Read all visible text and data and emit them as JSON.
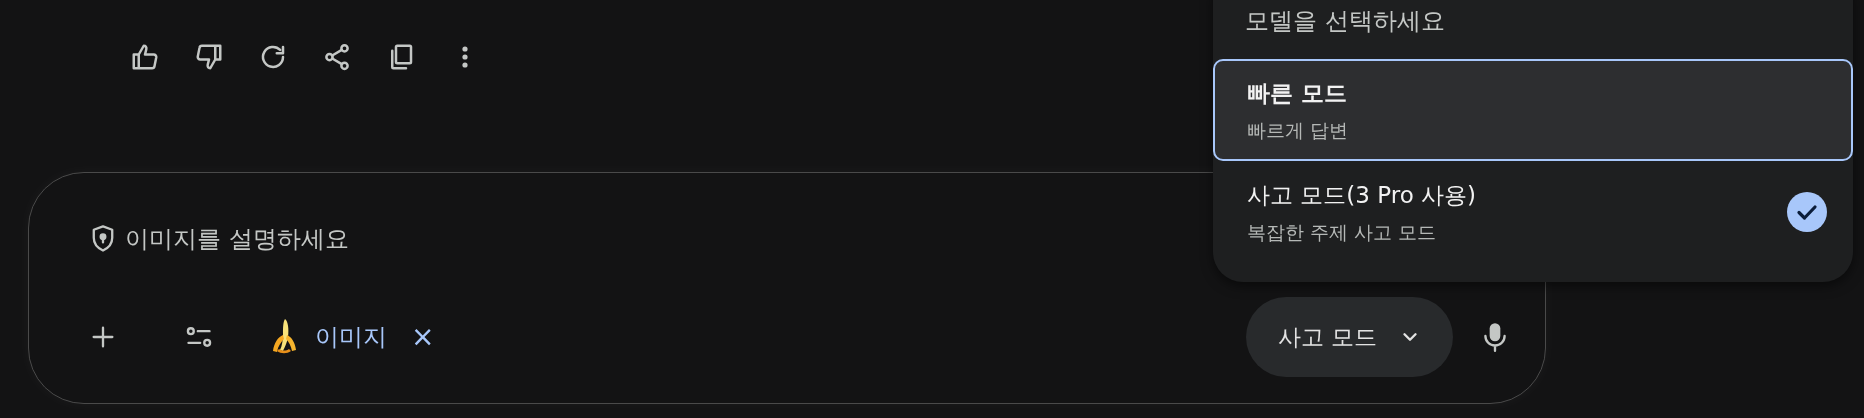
{
  "response_actions": [
    {
      "kind": "thumbs-up"
    },
    {
      "kind": "thumbs-down"
    },
    {
      "kind": "refresh"
    },
    {
      "kind": "share"
    },
    {
      "kind": "copy"
    },
    {
      "kind": "more"
    }
  ],
  "prompt": {
    "placeholder": "이미지를 설명하세요",
    "tool_chip": {
      "label": "이미지",
      "remove": "×"
    },
    "mode_button": "사고 모드"
  },
  "model_menu": {
    "title": "모델을 선택하세요",
    "items": [
      {
        "label": "빠른 모드",
        "description": "빠르게 답변",
        "focused": true,
        "selected": false
      },
      {
        "label": "사고 모드(3 Pro 사용)",
        "description": "복잡한 주제 사고 모드",
        "focused": false,
        "selected": true
      }
    ]
  }
}
